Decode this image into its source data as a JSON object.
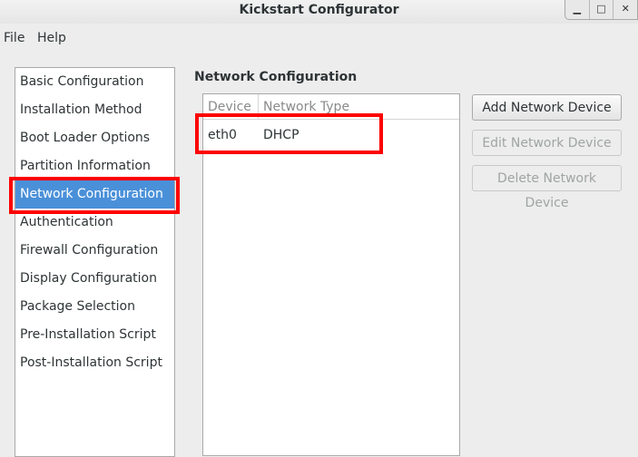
{
  "window": {
    "title": "Kickstart Configurator",
    "controls": {
      "minimize": "▁",
      "maximize": "□",
      "close": "✕"
    }
  },
  "menubar": {
    "items": [
      "File",
      "Help"
    ]
  },
  "sidebar": {
    "selected_index": 4,
    "items": [
      "Basic Configuration",
      "Installation Method",
      "Boot Loader Options",
      "Partition Information",
      "Network Configuration",
      "Authentication",
      "Firewall Configuration",
      "Display Configuration",
      "Package Selection",
      "Pre-Installation Script",
      "Post-Installation Script"
    ]
  },
  "main": {
    "section_title": "Network Configuration",
    "table": {
      "columns": [
        "Device",
        "Network Type"
      ],
      "rows": [
        [
          "eth0",
          "DHCP"
        ]
      ]
    },
    "buttons": {
      "add": {
        "label": "Add Network Device",
        "enabled": true
      },
      "edit": {
        "label": "Edit Network Device",
        "enabled": false
      },
      "delete": {
        "label": "Delete Network Device",
        "enabled": false
      }
    }
  },
  "colors": {
    "selection": "#4a90d9",
    "highlight_box": "#ff0000"
  }
}
